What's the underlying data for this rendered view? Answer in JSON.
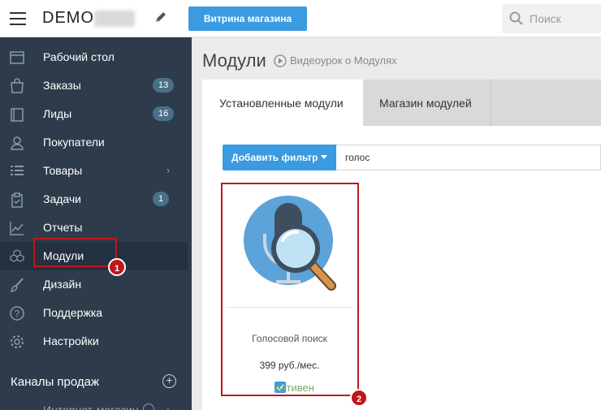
{
  "header": {
    "brand": "DEMO",
    "store_button": "Витрина магазина",
    "search_placeholder": "Поиск"
  },
  "sidebar": {
    "items": [
      {
        "label": "Рабочий стол",
        "icon": "desktop-icon"
      },
      {
        "label": "Заказы",
        "icon": "bag-icon",
        "badge": "13"
      },
      {
        "label": "Лиды",
        "icon": "card-icon",
        "badge": "16"
      },
      {
        "label": "Покупатели",
        "icon": "user-icon"
      },
      {
        "label": "Товары",
        "icon": "list-icon",
        "chevron": "›"
      },
      {
        "label": "Задачи",
        "icon": "clipboard-icon",
        "badge": "1"
      },
      {
        "label": "Отчеты",
        "icon": "chart-icon"
      },
      {
        "label": "Модули",
        "icon": "cubes-icon",
        "active": true
      },
      {
        "label": "Дизайн",
        "icon": "brush-icon"
      },
      {
        "label": "Поддержка",
        "icon": "help-icon"
      },
      {
        "label": "Настройки",
        "icon": "gear-icon"
      }
    ],
    "section_title": "Каналы продаж",
    "cut_item": "Интернет-магазин"
  },
  "annotations": {
    "first": "1",
    "second": "2"
  },
  "main": {
    "title": "Модули",
    "video_link": "Видеоурок о Модулях",
    "tabs": [
      {
        "label": "Установленные модули",
        "active": true
      },
      {
        "label": "Магазин модулей"
      }
    ],
    "filter_button": "Добавить фильтр",
    "filter_value": "голос",
    "module": {
      "title": "Голосовой поиск",
      "price": "399 руб./мес.",
      "status": "Активен"
    }
  },
  "colors": {
    "accent": "#3a9be0",
    "sidebar_bg": "#2d3b4a",
    "annotation_red": "#c0161e",
    "active_green": "#7aa86b"
  }
}
